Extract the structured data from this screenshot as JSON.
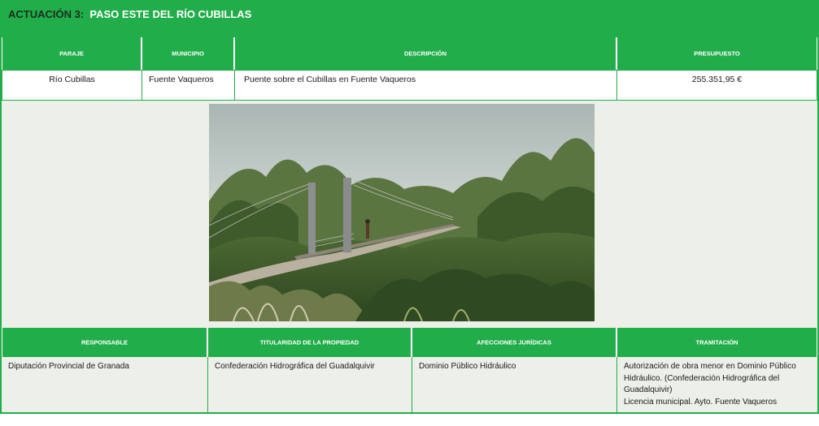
{
  "header": {
    "number": "ACTUACIÓN 3:",
    "name": "PASO ESTE DEL RÍO CUBILLAS"
  },
  "top_table": {
    "columns": [
      "PARAJE",
      "MUNICIPIO",
      "DESCRIPCIÓN",
      "PRESUPUESTO"
    ],
    "row": [
      "Río Cubillas",
      "Fuente Vaqueros",
      "Puente sobre el Cubillas en Fuente Vaqueros",
      "255.351,95 €"
    ]
  },
  "bottom_table": {
    "columns": [
      "RESPONSABLE",
      "TITULARIDAD DE LA PROPIEDAD",
      "AFECCIONES JURÍDICAS",
      "TRAMITACIÓN"
    ],
    "row": [
      "Diputación Provincial de Granada",
      "Confederación Hidrográfica del Guadalquivir",
      "Dominio Público Hidráulico",
      "Autorización de obra menor en Dominio Público Hidráulico. (Confederación Hidrográfica del Guadalquivir)"
    ],
    "tramitacion_extra": "Licencia municipal. Ayto. Fuente Vaqueros"
  },
  "colors": {
    "accent": "#22ad4b",
    "panel": "#ecf0e8",
    "text": "#1a1a1a"
  },
  "image": {
    "icon": "bridge-render-image"
  }
}
